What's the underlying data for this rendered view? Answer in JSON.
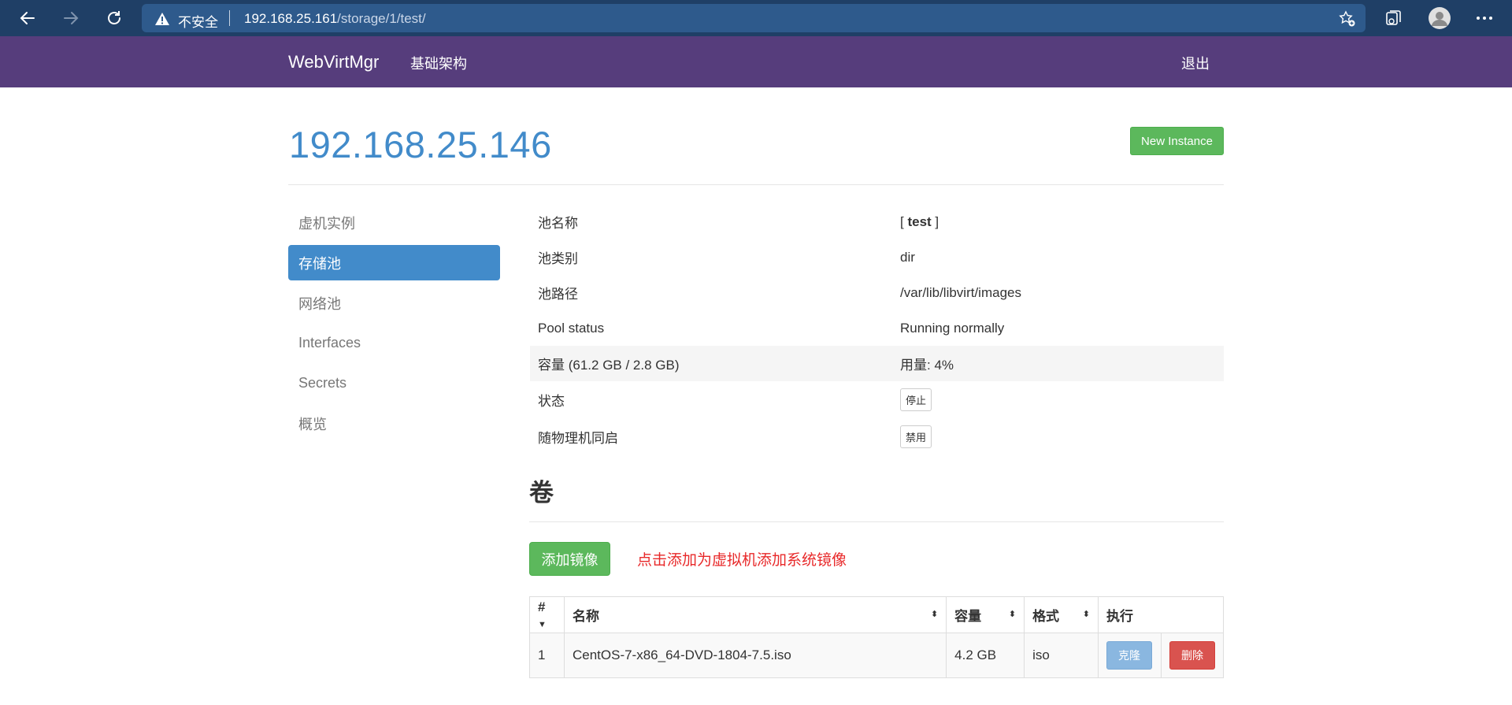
{
  "browser": {
    "insecure_label": "不安全",
    "url_host": "192.168.25.161",
    "url_path": "/storage/1/test/"
  },
  "navbar": {
    "brand": "WebVirtMgr",
    "infrastructure": "基础架构",
    "logout": "退出"
  },
  "header": {
    "title": "192.168.25.146",
    "new_instance": "New Instance"
  },
  "sidebar": {
    "items": [
      {
        "label": "虚机实例",
        "active": false
      },
      {
        "label": "存储池",
        "active": true
      },
      {
        "label": "网络池",
        "active": false
      },
      {
        "label": "Interfaces",
        "active": false
      },
      {
        "label": "Secrets",
        "active": false
      },
      {
        "label": "概览",
        "active": false
      }
    ]
  },
  "pool": {
    "name_label": "池名称",
    "name_prefix": "[ ",
    "name_value": "test",
    "name_suffix": " ]",
    "type_label": "池类别",
    "type_value": "dir",
    "path_label": "池路径",
    "path_value": "/var/lib/libvirt/images",
    "status_label": "Pool status",
    "status_value": "Running normally",
    "capacity_label": "容量 (61.2 GB / 2.8 GB)",
    "usage_value": "用量: 4%",
    "state_label": "状态",
    "stop_button": "停止",
    "autostart_label": "随物理机同启",
    "disable_button": "禁用"
  },
  "volumes": {
    "title": "卷",
    "add_button": "添加镜像",
    "hint": "点击添加为虚拟机添加系统镜像",
    "columns": {
      "index": "#",
      "name": "名称",
      "size": "容量",
      "format": "格式",
      "action": "执行"
    },
    "rows": [
      {
        "index": "1",
        "name": "CentOS-7-x86_64-DVD-1804-7.5.iso",
        "size": "4.2 GB",
        "format": "iso",
        "clone": "克隆",
        "delete": "删除"
      }
    ]
  },
  "colors": {
    "navbar": "#563d7c",
    "browser_bar": "#1f3f66",
    "primary": "#428bca",
    "success": "#5cb85c",
    "danger": "#d9534f",
    "hint": "#e8292a"
  }
}
